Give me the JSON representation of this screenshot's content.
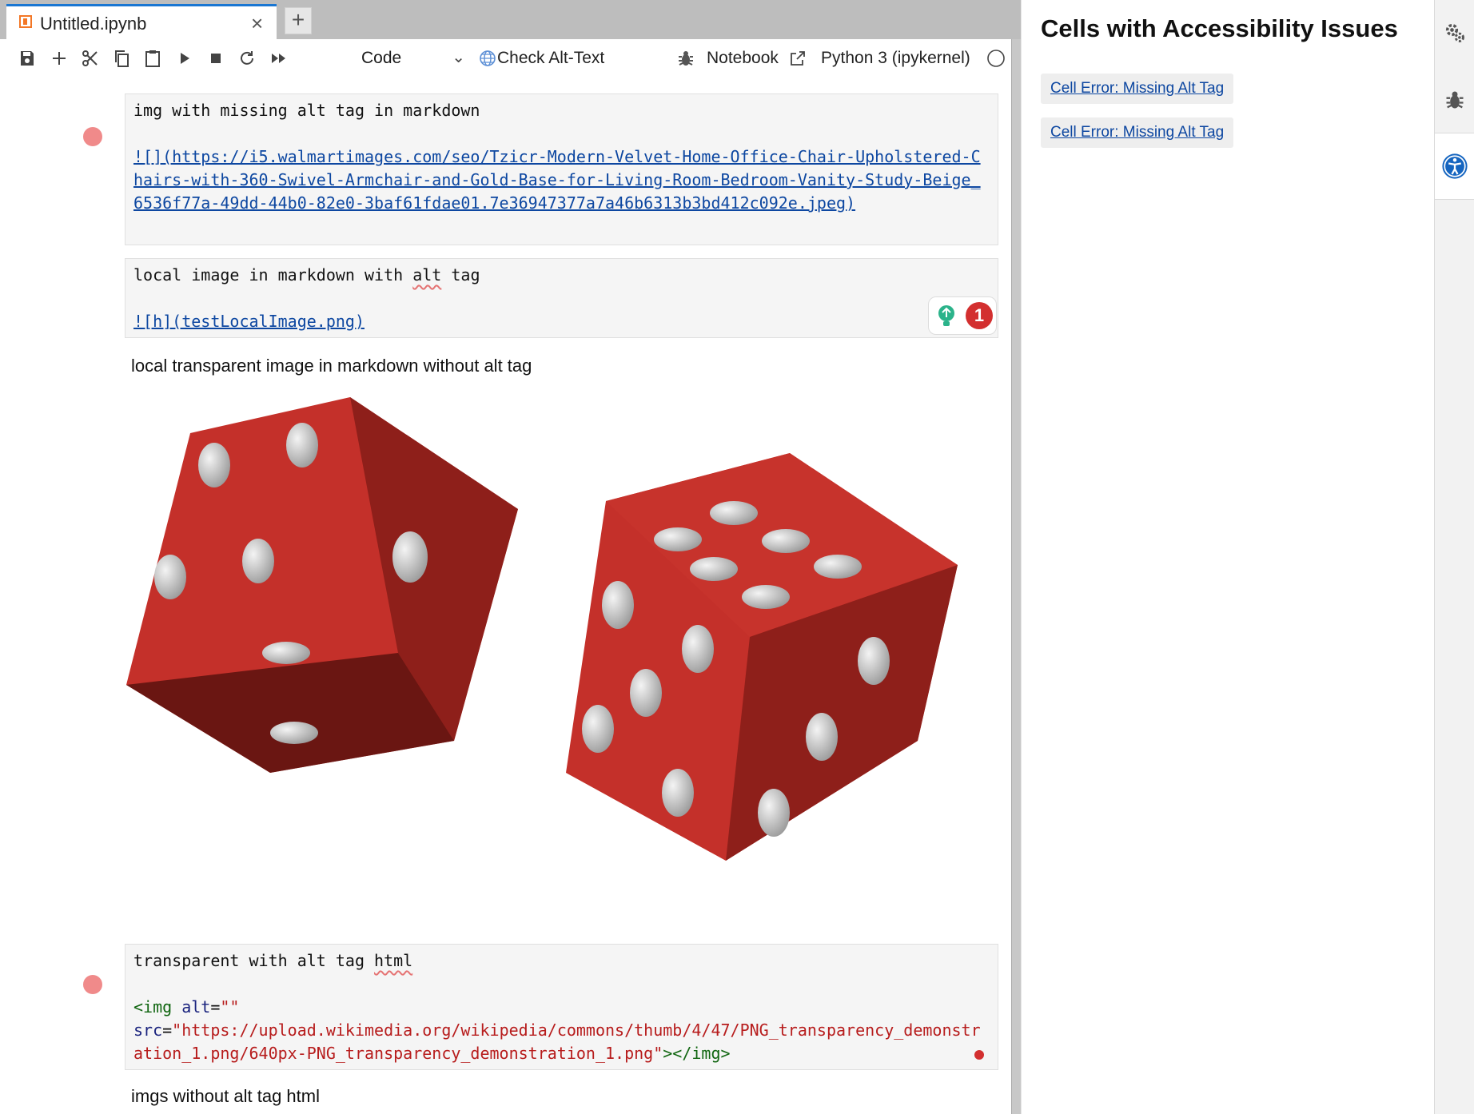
{
  "tab": {
    "title": "Untitled.ipynb",
    "close": "×",
    "new_tab": "+"
  },
  "toolbar": {
    "cell_type": "Code",
    "check_alt_text": "Check Alt-Text",
    "notebook": "Notebook",
    "kernel": "Python 3 (ipykernel)"
  },
  "cells": {
    "c1": {
      "line1": "img with missing alt tag in markdown",
      "link": "![](https://i5.walmartimages.com/seo/Tzicr-Modern-Velvet-Home-Office-Chair-Upholstered-Chairs-with-360-Swivel-Armchair-and-Gold-Base-for-Living-Room-Bedroom-Vanity-Study-Beige_6536f77a-49dd-44b0-82e0-3baf61fdae01.7e36947377a7a46b6313b3bd412c092e.jpeg)"
    },
    "c2": {
      "line1_a": "local image in markdown with ",
      "line1_b": "alt",
      "line1_c": " tag",
      "link": "![h](testLocalImage.png)",
      "badge": "1"
    },
    "c3": {
      "text": "local transparent image in markdown without alt tag"
    },
    "c4": {
      "line1_a": "transparent with alt tag ",
      "line1_b": "html",
      "tag_open": "<img",
      "alt_attr": "alt",
      "eq": "=",
      "alt_val": "\"\"",
      "src_attr": "src",
      "src_val": "\"https://upload.wikimedia.org/wikipedia/commons/thumb/4/47/PNG_transparency_demonstration_1.png/640px-PNG_transparency_demonstration_1.png\"",
      "tag_close": "></img>"
    },
    "c5": {
      "text": "imgs without alt tag html"
    }
  },
  "panel": {
    "title": "Cells with Accessibility Issues",
    "issues": [
      "Cell Error: Missing Alt Tag",
      "Cell Error: Missing Alt Tag"
    ]
  },
  "colors": {
    "accent": "#1976d2",
    "error_dot": "#f08a8a",
    "badge": "#d32f2f",
    "dice": "#b52a22"
  }
}
